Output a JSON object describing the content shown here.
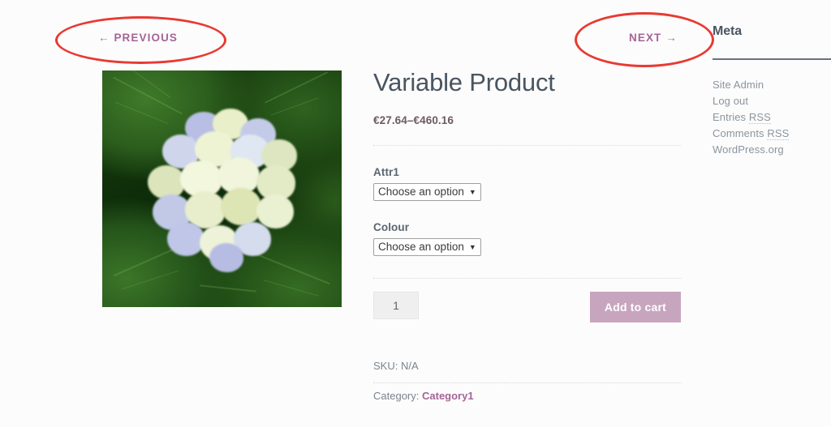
{
  "navigation": {
    "previous_label": "← PREVIOUS",
    "next_label": "NEXT →",
    "link_color": "#a46497"
  },
  "annotations": {
    "color": "#e83a32",
    "shapes": [
      "ellipse-around-previous",
      "ellipse-around-next"
    ]
  },
  "product": {
    "title": "Variable Product",
    "price": "€27.64–€460.16",
    "image_alt": "hydrangea-flower-photo",
    "attributes": [
      {
        "label": "Attr1",
        "selected": "Choose an option",
        "caret": "▼"
      },
      {
        "label": "Colour",
        "selected": "Choose an option",
        "caret": "▼"
      }
    ],
    "quantity": "1",
    "add_to_cart_label": "Add to cart",
    "add_to_cart_color": "#c8a5bf",
    "sku_label": "SKU:",
    "sku_value": "N/A",
    "category_label": "Category:",
    "category_value": "Category1"
  },
  "sidebar": {
    "title": "Meta",
    "items": [
      {
        "label": "Site Admin",
        "abbr": ""
      },
      {
        "label": "Log out",
        "abbr": ""
      },
      {
        "label": "Entries ",
        "abbr": "RSS"
      },
      {
        "label": "Comments ",
        "abbr": "RSS"
      },
      {
        "label": "WordPress.org",
        "abbr": ""
      }
    ]
  }
}
